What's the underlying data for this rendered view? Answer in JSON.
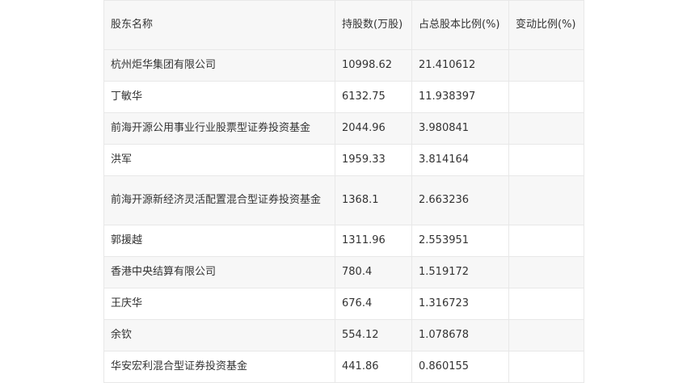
{
  "table": {
    "headers": [
      "股东名称",
      "持股数(万股)",
      "占总股本比例(%)",
      "变动比例(%)"
    ],
    "rows": [
      {
        "name": "杭州炬华集团有限公司",
        "shares": "10998.62",
        "ratio": "21.410612",
        "change": ""
      },
      {
        "name": "丁敏华",
        "shares": "6132.75",
        "ratio": "11.938397",
        "change": ""
      },
      {
        "name": "前海开源公用事业行业股票型证券投资基金",
        "shares": "2044.96",
        "ratio": "3.980841",
        "change": ""
      },
      {
        "name": "洪军",
        "shares": "1959.33",
        "ratio": "3.814164",
        "change": ""
      },
      {
        "name": "前海开源新经济灵活配置混合型证券投资基金",
        "shares": "1368.1",
        "ratio": "2.663236",
        "change": ""
      },
      {
        "name": "郭援越",
        "shares": "1311.96",
        "ratio": "2.553951",
        "change": ""
      },
      {
        "name": "香港中央结算有限公司",
        "shares": "780.4",
        "ratio": "1.519172",
        "change": ""
      },
      {
        "name": "王庆华",
        "shares": "676.4",
        "ratio": "1.316723",
        "change": ""
      },
      {
        "name": "余钦",
        "shares": "554.12",
        "ratio": "1.078678",
        "change": ""
      },
      {
        "name": "华安宏利混合型证券投资基金",
        "shares": "441.86",
        "ratio": "0.860155",
        "change": ""
      }
    ]
  }
}
